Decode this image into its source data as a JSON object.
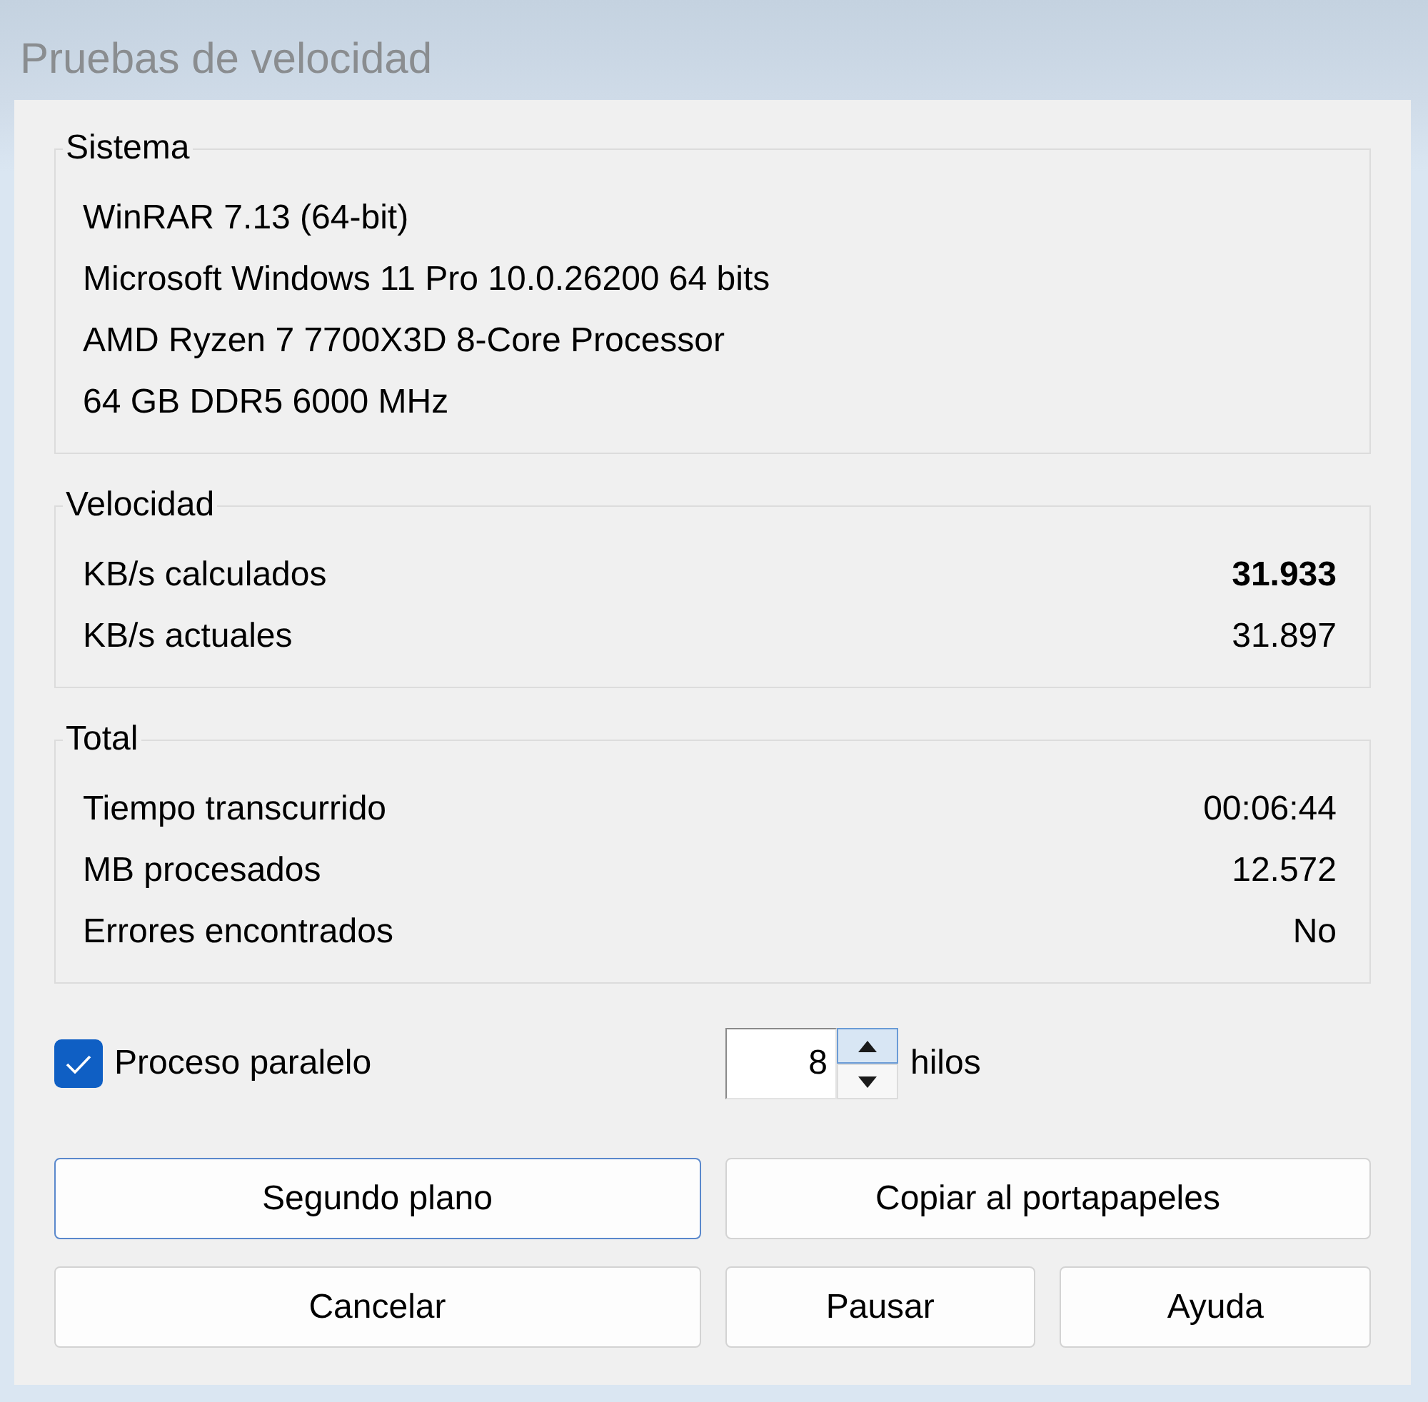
{
  "window": {
    "title": "Pruebas de velocidad"
  },
  "groups": [
    {
      "title": "Sistema",
      "lines": [
        "WinRAR 7.13 (64-bit)",
        "Microsoft Windows 11 Pro 10.0.26200 64 bits",
        "AMD Ryzen 7 7700X3D 8-Core Processor",
        "64 GB DDR5 6000 MHz"
      ]
    },
    {
      "title": "Velocidad",
      "rows": [
        {
          "label": "KB/s calculados",
          "value": "31.933",
          "bold": true
        },
        {
          "label": "KB/s actuales",
          "value": "31.897",
          "bold": false
        }
      ]
    },
    {
      "title": "Total",
      "rows": [
        {
          "label": "Tiempo transcurrido",
          "value": "00:06:44",
          "bold": false
        },
        {
          "label": "MB procesados",
          "value": "12.572",
          "bold": false
        },
        {
          "label": "Errores encontrados",
          "value": "No",
          "bold": false
        }
      ]
    }
  ],
  "parallel": {
    "label": "Proceso paralelo",
    "checked": true
  },
  "threads": {
    "value": "8",
    "unit": "hilos",
    "arrows": [
      {
        "kind": "up",
        "hovered": true
      },
      {
        "kind": "down",
        "hovered": false
      }
    ]
  },
  "button_rows": [
    [
      {
        "label": "Segundo plano",
        "default": true
      },
      {
        "label": "Copiar al portapapeles",
        "default": false
      }
    ],
    [
      {
        "label": "Cancelar",
        "default": false
      },
      {
        "label": "Pausar",
        "default": false
      },
      {
        "label": "Ayuda",
        "default": false
      }
    ]
  ]
}
